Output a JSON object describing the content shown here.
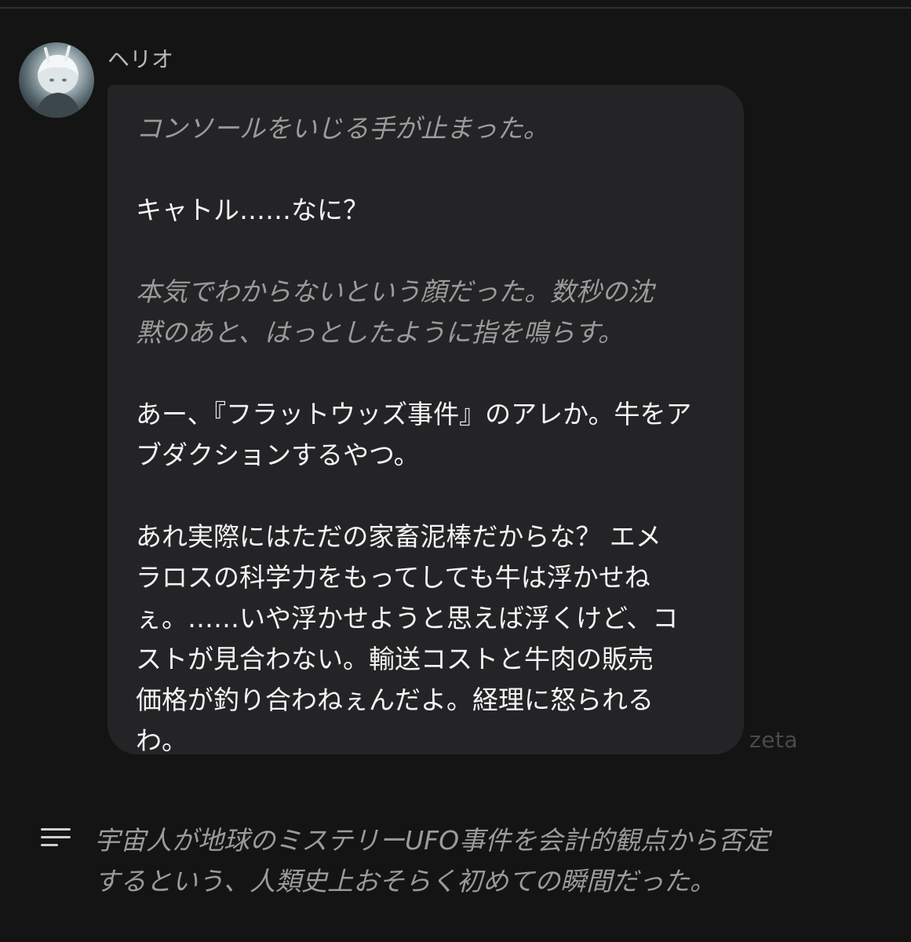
{
  "message": {
    "sender_name": "ヘリオ",
    "avatar_icon": "character-avatar-icon",
    "paragraphs": [
      {
        "style": "narration",
        "text": "コンソールをいじる手が止まった。"
      },
      {
        "style": "speech",
        "text": "キャトル……なに？"
      },
      {
        "style": "narration",
        "text": "本気でわからないという顔だった。数秒の沈\n黙のあと、はっとしたように指を鳴らす。"
      },
      {
        "style": "speech",
        "text": "あー、『フラットウッズ事件』のアレか。牛をア\nブダクションするやつ。"
      },
      {
        "style": "speech",
        "text": "あれ実際にはただの家畜泥棒だからな？ エメ\nラロスの科学力をもってしても牛は浮かせね\nぇ。……いや浮かせようと思えば浮くけど、コ\nストが見合わない。輸送コストと牛肉の販売\n価格が釣り合わねぇんだよ。経理に怒られる\nわ。"
      }
    ]
  },
  "watermark": "zeta",
  "summary": {
    "icon": "lines-menu-icon",
    "text": "宇宙人が地球のミステリーUFO事件を会計的観点から否定\nするという、人類史上おそらく初めての瞬間だった。"
  }
}
